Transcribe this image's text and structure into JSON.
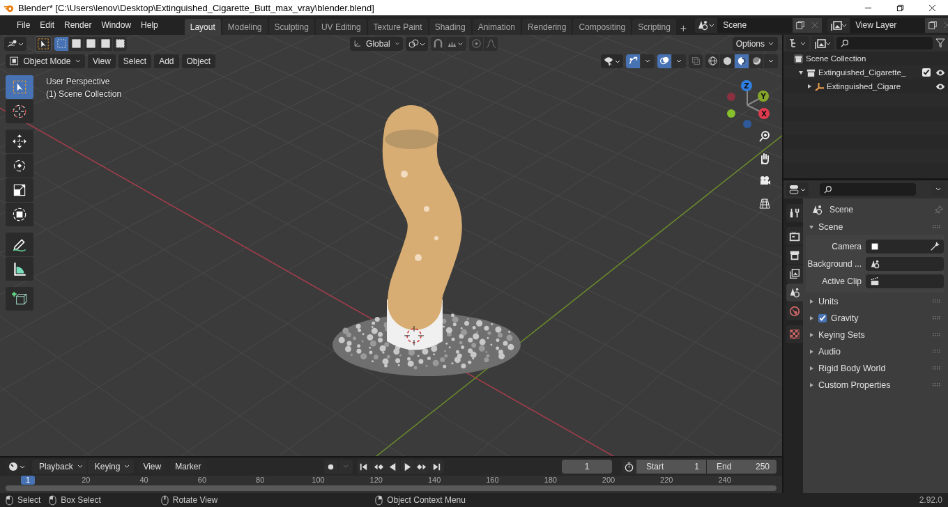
{
  "window": {
    "title": "Blender* [C:\\Users\\lenov\\Desktop\\Extinguished_Cigarette_Butt_max_vray\\blender.blend]"
  },
  "menu": [
    "File",
    "Edit",
    "Render",
    "Window",
    "Help"
  ],
  "workspaces": [
    {
      "label": "Layout",
      "selected": true
    },
    {
      "label": "Modeling",
      "selected": false
    },
    {
      "label": "Sculpting",
      "selected": false
    },
    {
      "label": "UV Editing",
      "selected": false
    },
    {
      "label": "Texture Paint",
      "selected": false
    },
    {
      "label": "Shading",
      "selected": false
    },
    {
      "label": "Animation",
      "selected": false
    },
    {
      "label": "Rendering",
      "selected": false
    },
    {
      "label": "Compositing",
      "selected": false
    },
    {
      "label": "Scripting",
      "selected": false
    }
  ],
  "add_workspace": "+",
  "scene_field": {
    "value": "Scene"
  },
  "view_layer_field": {
    "value": "View Layer"
  },
  "viewport": {
    "selection_modes": [
      {
        "selected": true
      },
      {
        "selected": false
      },
      {
        "selected": false
      },
      {
        "selected": false
      },
      {
        "selected": false
      }
    ],
    "orientation": "Global",
    "options": "Options",
    "mode": "Object Mode",
    "menus": [
      "View",
      "Select",
      "Add",
      "Object"
    ],
    "toggles": [
      {
        "kind": "gizmo",
        "on": true
      },
      {
        "kind": "overlay",
        "on": true
      },
      {
        "kind": "xray",
        "on": false
      }
    ],
    "shading_modes": [
      {
        "kind": "wireframe",
        "selected": false
      },
      {
        "kind": "solid",
        "selected": false
      },
      {
        "kind": "material",
        "selected": true
      },
      {
        "kind": "rendered",
        "selected": false
      }
    ],
    "overlay_text": [
      "User Perspective",
      "(1) Scene Collection"
    ],
    "tools": [
      {
        "kind": "select-box",
        "selected": true
      },
      {
        "kind": "cursor",
        "selected": false
      },
      {
        "kind": "move",
        "selected": false
      },
      {
        "kind": "rotate",
        "selected": false
      },
      {
        "kind": "scale",
        "selected": false
      },
      {
        "kind": "transform",
        "selected": false
      },
      {
        "kind": "annotate",
        "selected": false
      },
      {
        "kind": "measure",
        "selected": false
      },
      {
        "kind": "add-cube",
        "selected": false
      }
    ],
    "gizmo_axes": [
      "Z",
      "Y",
      "X"
    ]
  },
  "outliner": {
    "items": [
      {
        "label": "Scene Collection",
        "kind": "scene-collection",
        "children": [
          {
            "label": "Extinguished_Cigarette_",
            "kind": "collection",
            "expanded": true,
            "checked": true,
            "children": [
              {
                "label": "Extinguished_Cigare",
                "kind": "object",
                "expanded": false
              }
            ]
          }
        ]
      }
    ]
  },
  "properties": {
    "title": "Scene",
    "tabs": [
      {
        "kind": "tool",
        "selected": false
      },
      {
        "kind": "render",
        "selected": false
      },
      {
        "kind": "output",
        "selected": false
      },
      {
        "kind": "view-layer",
        "selected": false
      },
      {
        "kind": "scene",
        "selected": true
      },
      {
        "kind": "world",
        "selected": false
      },
      {
        "kind": "texture",
        "selected": false
      }
    ],
    "panels": [
      {
        "label": "Scene",
        "kind": "panel",
        "expanded": true,
        "fields": [
          {
            "label": "Camera",
            "kind": "camera"
          },
          {
            "label": "Background ...",
            "kind": "scene"
          },
          {
            "label": "Active Clip",
            "kind": "clip"
          }
        ]
      },
      {
        "label": "Units",
        "kind": "panel",
        "expanded": false
      },
      {
        "label": "Gravity",
        "kind": "toggle",
        "expanded": false,
        "checked": true
      },
      {
        "label": "Keying Sets",
        "kind": "panel",
        "expanded": false
      },
      {
        "label": "Audio",
        "kind": "panel",
        "expanded": false
      },
      {
        "label": "Rigid Body World",
        "kind": "panel",
        "expanded": false
      },
      {
        "label": "Custom Properties",
        "kind": "panel",
        "expanded": false
      }
    ]
  },
  "timeline": {
    "menus": [
      "Playback",
      "Keying"
    ],
    "plain_menus": [
      "View",
      "Marker"
    ],
    "current_frame": "1",
    "start": {
      "label": "Start",
      "value": "1"
    },
    "end": {
      "label": "End",
      "value": "250"
    },
    "playhead": "1",
    "ruler": [
      "20",
      "40",
      "60",
      "80",
      "100",
      "120",
      "140",
      "160",
      "180",
      "200",
      "220",
      "240"
    ]
  },
  "status_bar": {
    "hints": [
      "Select",
      "Box Select",
      "Rotate View",
      "Object Context Menu"
    ],
    "version": "2.92.0"
  }
}
